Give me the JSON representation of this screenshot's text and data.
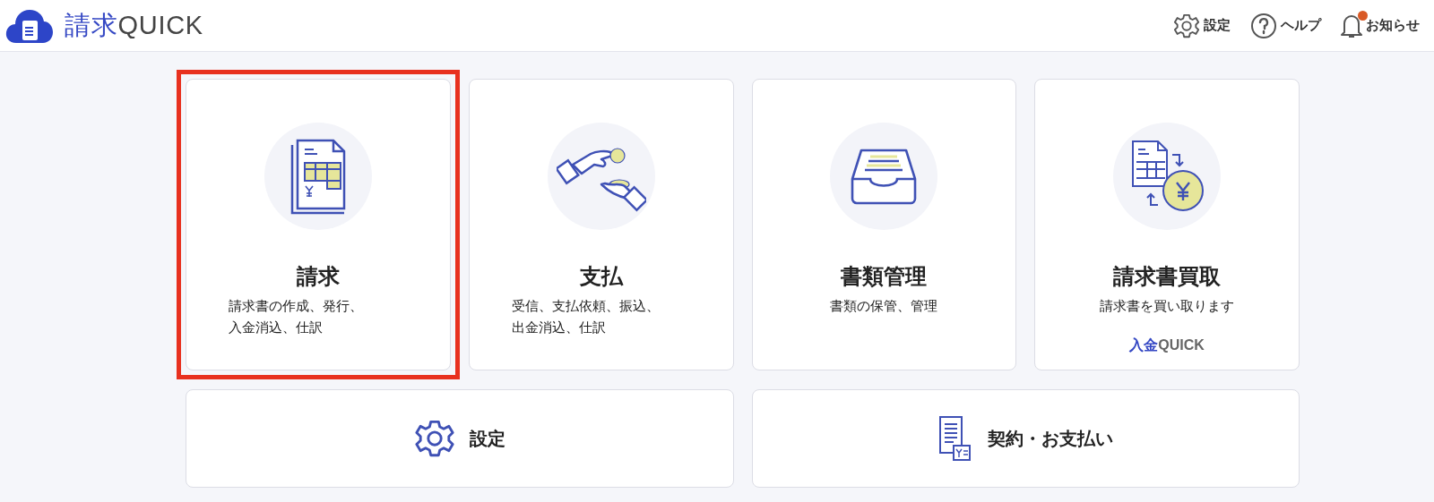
{
  "header": {
    "logo": {
      "primary": "請求",
      "secondary": "QUICK"
    },
    "actions": [
      {
        "kind": "settings",
        "label": "設定"
      },
      {
        "kind": "help",
        "label": "ヘルプ"
      },
      {
        "kind": "notifications",
        "label": "お知らせ",
        "unread": true
      }
    ]
  },
  "cards": [
    {
      "kind": "invoice",
      "title": "請求",
      "description": [
        "請求書の作成、発行、",
        "入金消込、仕訳"
      ],
      "highlighted": true
    },
    {
      "kind": "payment",
      "title": "支払",
      "description": [
        "受信、支払依頼、振込、",
        "出金消込、仕訳"
      ],
      "highlighted": false
    },
    {
      "kind": "documents",
      "title": "書類管理",
      "description": [
        "書類の保管、管理"
      ],
      "highlighted": false
    },
    {
      "kind": "factoring",
      "title": "請求書買取",
      "description": [
        "請求書を買い取ります"
      ],
      "highlighted": false,
      "brand": {
        "primary": "入金",
        "secondary": "QUICK"
      }
    }
  ],
  "wide_cards": [
    {
      "kind": "settings",
      "label": "設定"
    },
    {
      "kind": "contract",
      "label": "契約・お支払い"
    }
  ]
}
